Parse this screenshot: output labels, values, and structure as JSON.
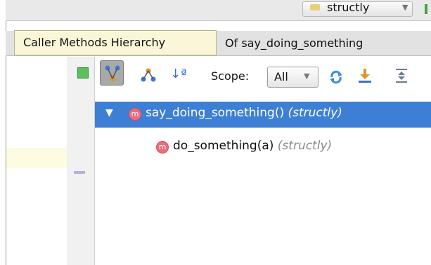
{
  "top_toolbar": {
    "project_combo_value": "structly",
    "project_combo_arrow": "▼"
  },
  "panel": {
    "title": "Of say_doing_something"
  },
  "tooltip": {
    "text": "Caller Methods Hierarchy"
  },
  "toolbar": {
    "scope_label": "Scope:",
    "scope_value": "All",
    "scope_arrow": "▼",
    "sort_alpha_glyph": "↓ª"
  },
  "icons": {
    "run": "green-square-icon",
    "caller_hierarchy": "caller-hierarchy-icon",
    "callee_hierarchy": "callee-hierarchy-icon",
    "sort_alpha": "sort-alphabetically-icon",
    "refresh": "refresh-icon",
    "export": "export-icon",
    "expand_all": "expand-all-icon"
  },
  "tree": {
    "rows": [
      {
        "icon_letter": "m",
        "name": "say_doing_something()",
        "context": "(structly)",
        "expanded": true,
        "selected": true
      },
      {
        "icon_letter": "m",
        "name": "do_something(a)",
        "context": "(structly)",
        "expanded": false,
        "selected": false
      }
    ]
  },
  "colors": {
    "selection": "#3d7fd4",
    "method_icon": "#f06c7a",
    "tooltip_bg": "#f9f7d8"
  }
}
